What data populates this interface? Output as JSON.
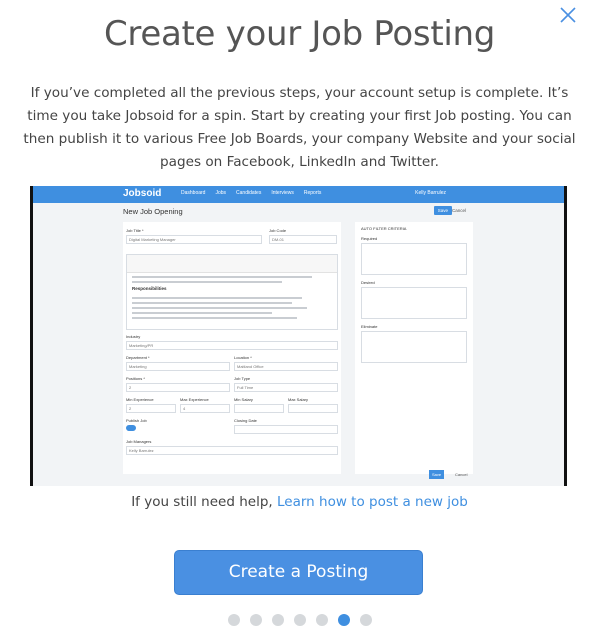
{
  "modal": {
    "title": "Create your Job Posting",
    "intro": "If you’ve completed all the previous steps, your account setup is complete. It’s time you take Jobsoid for a spin. Start by creating your first Job posting. You can then publish it to various Free Job Boards, your company Website and your social pages on Facebook, LinkedIn and Twitter.",
    "close_icon": "close-icon"
  },
  "screenshot": {
    "logo": "Jobsoid",
    "nav": [
      "Dashboard",
      "Jobs",
      "Candidates",
      "Interviews",
      "Reports"
    ],
    "user": "Kelly Barrulez",
    "page_title": "New Job Opening",
    "save": "Save",
    "cancel": "Cancel",
    "labels": {
      "job_title": "Job Title *",
      "job_code": "Job Code",
      "industry": "Industry",
      "department": "Department *",
      "location": "Location *",
      "positions": "Positions *",
      "job_type": "Job Type",
      "min_exp": "Min Experience",
      "max_exp": "Max Experience",
      "min_salary": "Min Salary",
      "max_salary": "Max Salary",
      "publish": "Publish Job",
      "closing": "Closing Date",
      "managers": "Job Managers",
      "auto_filter": "AUTO FILTER CRITERIA",
      "required": "Required",
      "desired": "Desired",
      "eliminate": "Eliminate",
      "responsibilities": "Responsibilities"
    },
    "values": {
      "job_title": "Digital Marketing Manager",
      "job_code": "DM-01",
      "industry": "Marketing/PR",
      "department": "Marketing",
      "location": "Maitland Office",
      "positions": "2",
      "job_type": "Full Time",
      "min_exp": "2",
      "max_exp": "4",
      "manager": "Kelly Barrulez"
    }
  },
  "help": {
    "prefix": "If you still need help, ",
    "link": "Learn how to post a new job"
  },
  "cta": {
    "label": "Create a Posting"
  },
  "pager": {
    "count": 7,
    "active_index": 5
  }
}
